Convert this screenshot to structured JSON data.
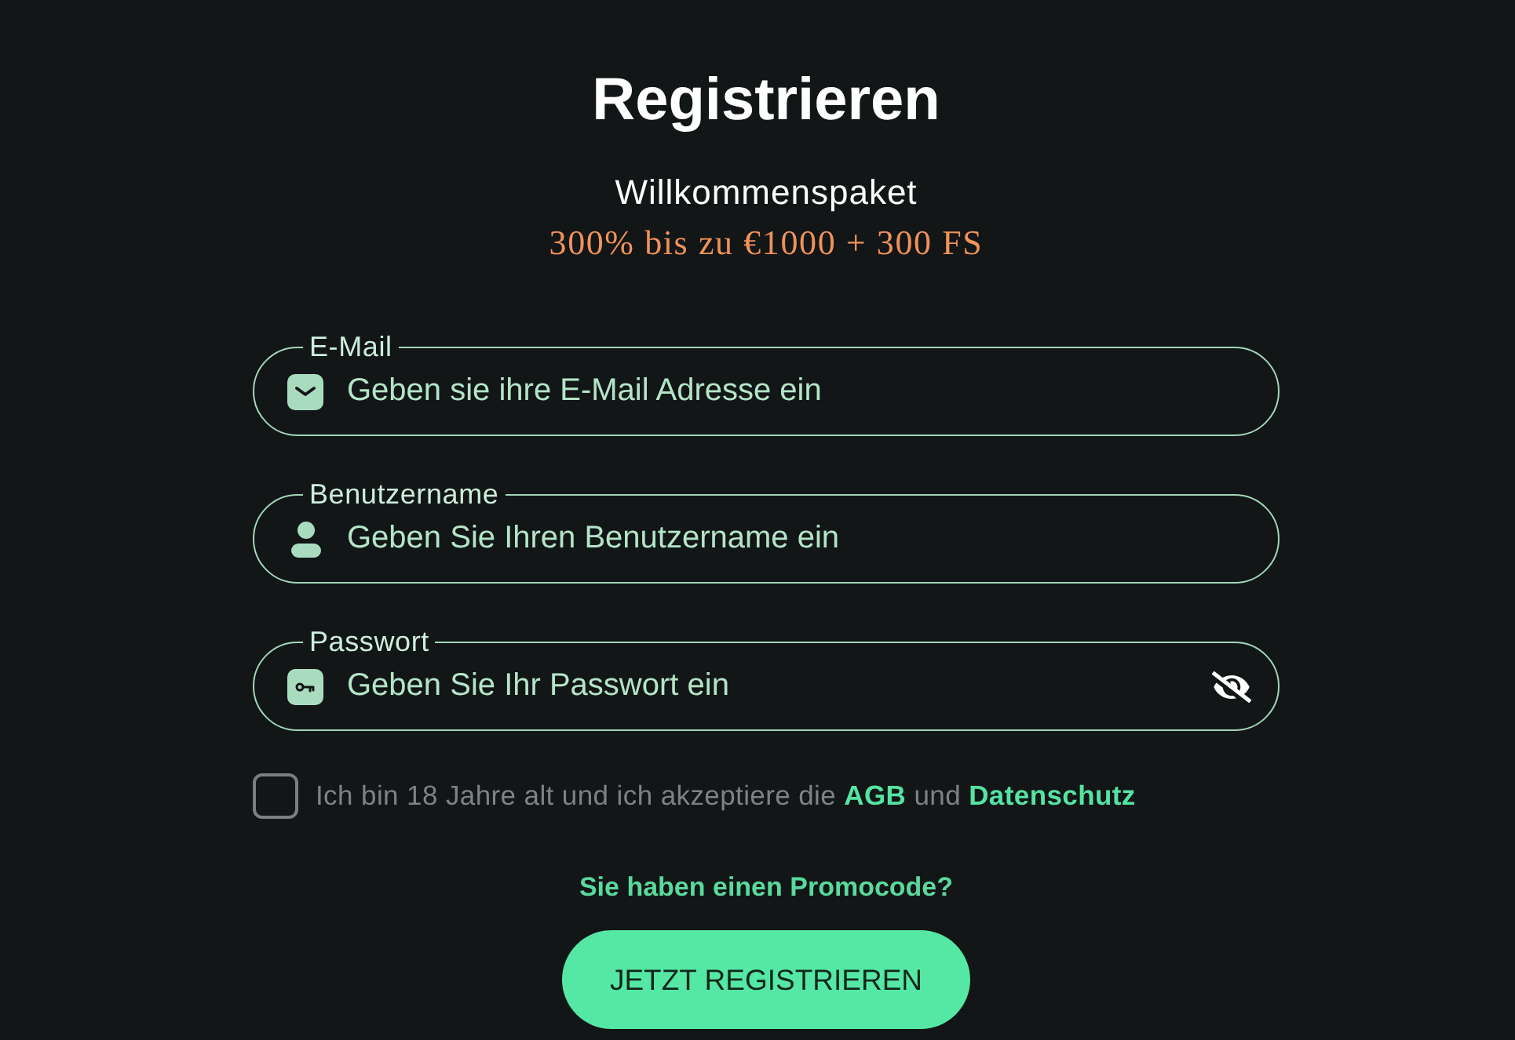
{
  "title": "Registrieren",
  "welcome": {
    "heading": "Willkommenspaket",
    "offer": "300% bis zu €1000 + 300 FS"
  },
  "fields": [
    {
      "kind": "email",
      "label": "E-Mail",
      "placeholder": "Geben sie ihre E-Mail Adresse ein"
    },
    {
      "kind": "user",
      "label": "Benutzername",
      "placeholder": "Geben Sie Ihren Benutzername ein"
    },
    {
      "kind": "password",
      "label": "Passwort",
      "placeholder": "Geben Sie Ihr Passwort ein"
    }
  ],
  "consent": {
    "checked": false,
    "parts": [
      {
        "kind": "text",
        "text": "Ich bin 18 Jahre alt und ich akzeptiere die"
      },
      {
        "kind": "link",
        "text": "AGB"
      },
      {
        "kind": "text",
        "text": "und"
      },
      {
        "kind": "link",
        "text": "Datenschutz"
      }
    ]
  },
  "promo_link": "Sie haben einen Promocode?",
  "submit_button": "JETZT REGISTRIEREN"
}
